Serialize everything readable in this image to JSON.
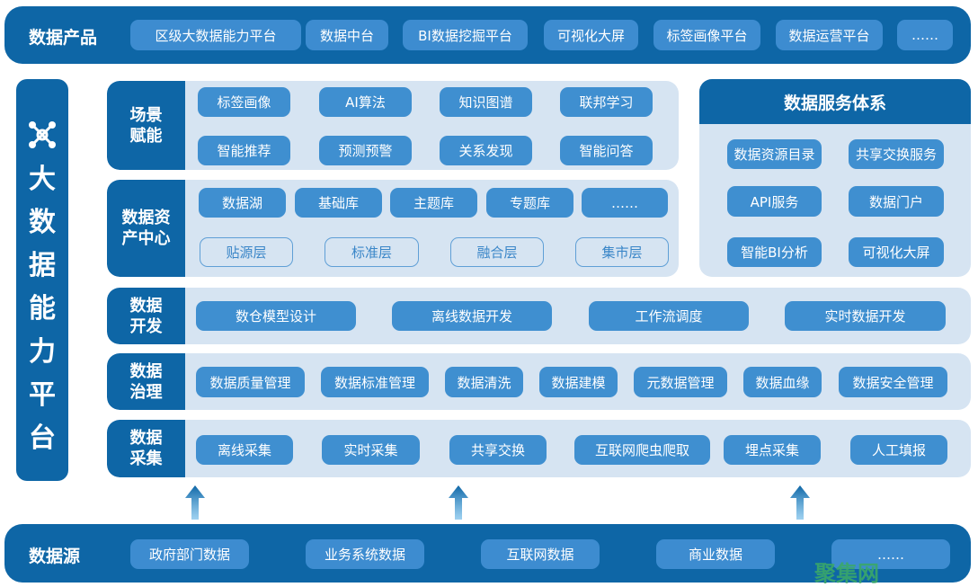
{
  "colors": {
    "dark": "#0e66a6",
    "chip": "#3f8fd0",
    "panel": "#d6e4f2",
    "watermark": "#3aa86a"
  },
  "products": {
    "label": "数据产品",
    "items": [
      "区级大数据能力平台",
      "数据中台",
      "BI数据挖掘平台",
      "可视化大屏",
      "标签画像平台",
      "数据运营平台",
      "……"
    ]
  },
  "side": {
    "icon": "network-nodes-icon",
    "chars": [
      "大",
      "数",
      "据",
      "能",
      "力",
      "平",
      "台"
    ]
  },
  "scene": {
    "label": "场景赋能",
    "items": [
      "标签画像",
      "AI算法",
      "知识图谱",
      "联邦学习",
      "智能推荐",
      "预测预警",
      "关系发现",
      "智能问答"
    ]
  },
  "service": {
    "title": "数据服务体系",
    "items": [
      "数据资源目录",
      "共享交换服务",
      "API服务",
      "数据门户",
      "智能BI分析",
      "可视化大屏"
    ]
  },
  "asset": {
    "label": "数据资产中心",
    "items": [
      "数据湖",
      "基础库",
      "主题库",
      "专题库",
      "……"
    ],
    "layers": [
      "贴源层",
      "标准层",
      "融合层",
      "集市层"
    ]
  },
  "dev": {
    "label": "数据开发",
    "items": [
      "数仓模型设计",
      "离线数据开发",
      "工作流调度",
      "实时数据开发"
    ]
  },
  "gov": {
    "label": "数据治理",
    "items": [
      "数据质量管理",
      "数据标准管理",
      "数据清洗",
      "数据建模",
      "元数据管理",
      "数据血缘",
      "数据安全管理"
    ]
  },
  "collect": {
    "label": "数据采集",
    "items": [
      "离线采集",
      "实时采集",
      "共享交换",
      "互联网爬虫爬取",
      "埋点采集",
      "人工填报"
    ]
  },
  "sources": {
    "label": "数据源",
    "items": [
      "政府部门数据",
      "业务系统数据",
      "互联网数据",
      "商业数据",
      "……"
    ]
  },
  "watermark": "聚集网"
}
